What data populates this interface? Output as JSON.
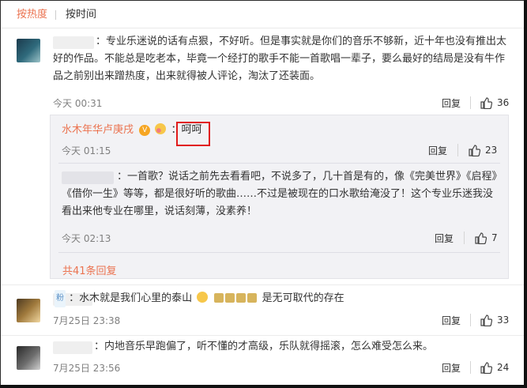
{
  "sort": {
    "hot_label": "按热度",
    "time_label": "按时间"
  },
  "comments": [
    {
      "text": "：专业乐迷说的话有点狠，不好听。但是事实就是你们的音乐不够新，近十年也没有推出太好的作品。不能总是吃老本，毕竟一个经打的歌手不能一首歌唱一辈子，要么最好的结局是没有牛作品之前别出来蹭热度，出来就得被人评论，淘汰了还装面。",
      "time": "今天 00:31",
      "reply": "回复",
      "likes": "36"
    },
    {
      "text": "：水木就是我们心里的泰山",
      "text_tail": "是无可取代的存在",
      "badge": "粉",
      "time": "7月25日 23:38",
      "reply": "回复",
      "likes": "33"
    },
    {
      "text": "：内地音乐早跑偏了，听不懂的才高级，乐队就得摇滚，怎么难受怎么来。",
      "time": "7月25日 23:56",
      "reply": "回复",
      "likes": "24"
    }
  ],
  "replies": {
    "first": {
      "name": "水木年华卢庚戌",
      "text": "：呵呵",
      "time": "今天 01:15",
      "reply": "回复",
      "likes": "23"
    },
    "second": {
      "text": "：一首歌？说话之前先去看看吧，不说多了，几十首是有的，像《完美世界》《启程》《借你一生》等等，都是很好听的歌曲……不过是被现在的口水歌给淹没了！这个专业乐迷我没看出来他专业在哪里，说话刻薄，没素养！",
      "time": "今天 02:13",
      "reply": "回复",
      "likes": "7"
    },
    "more_label": "共41条回复"
  },
  "colors": {
    "accent": "#eb7350",
    "highlight": "#e11a1a"
  }
}
